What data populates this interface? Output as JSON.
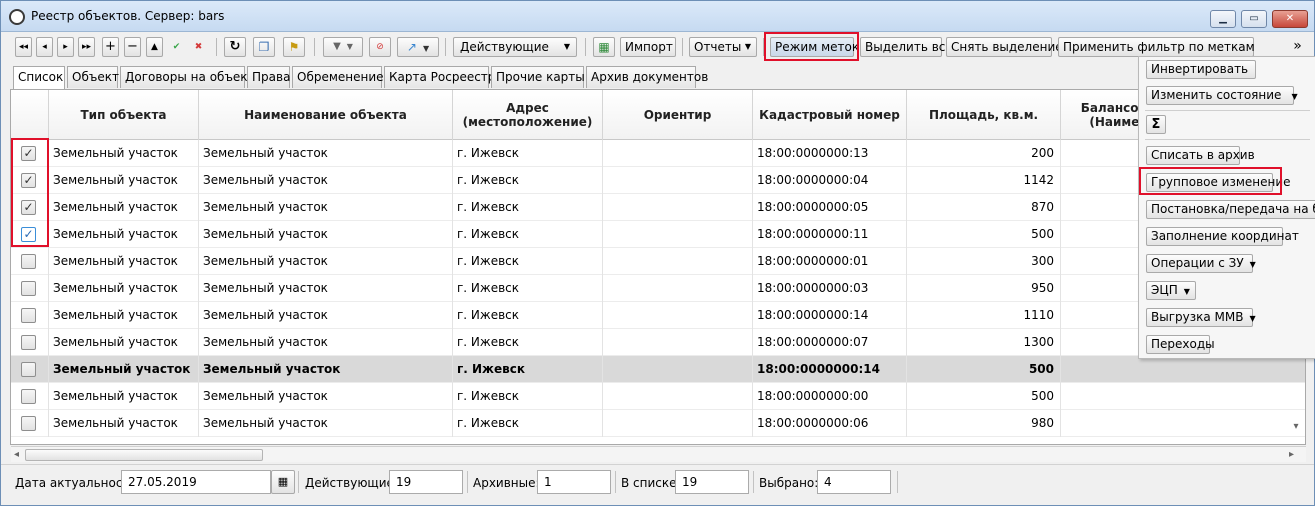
{
  "window": {
    "title": "Реестр объектов. Сервер: bars"
  },
  "toolbar": {
    "nav_first": "◂◂",
    "nav_prev": "◂",
    "nav_next": "▸",
    "nav_last": "▸▸",
    "add": "+",
    "remove": "−",
    "up": "▲",
    "apply": "✔",
    "cancel": "✖",
    "refresh": "↻",
    "copy": "❐",
    "flag": "⚑",
    "filter": "▼",
    "filter_clear": "⊘",
    "arrow": "↗",
    "status_filter": "Действующие",
    "import": "Импорт",
    "reports": "Отчеты",
    "mark_mode": "Режим меток",
    "select_all": "Выделить все",
    "clear_selection": "Снять выделение",
    "apply_filter": "Применить фильтр по меткам",
    "more": "»"
  },
  "tabs": [
    "Список",
    "Объект",
    "Договоры на объект",
    "Права",
    "Обременение",
    "Карта Росреестра",
    "Прочие карты",
    "Архив документов"
  ],
  "grid": {
    "columns": {
      "type": "Тип объекта",
      "name": "Наименование объекта",
      "address": "Адрес (местоположение)",
      "landmark": "Ориентир",
      "cadastral": "Кадастровый номер",
      "area": "Площадь, кв.м.",
      "balance": "Балансоде (Наимен"
    },
    "rows": [
      {
        "checked": true,
        "type": "Земельный участок",
        "name": "Земельный участок",
        "address": "г. Ижевск",
        "landmark": "",
        "cadastral": "18:00:0000000:13",
        "area": "200"
      },
      {
        "checked": true,
        "type": "Земельный участок",
        "name": "Земельный участок",
        "address": "г. Ижевск",
        "landmark": "",
        "cadastral": "18:00:0000000:04",
        "area": "1142"
      },
      {
        "checked": true,
        "type": "Земельный участок",
        "name": "Земельный участок",
        "address": "г. Ижевск",
        "landmark": "",
        "cadastral": "18:00:0000000:05",
        "area": "870"
      },
      {
        "checked": true,
        "type": "Земельный участок",
        "name": "Земельный участок",
        "address": "г. Ижевск",
        "landmark": "",
        "cadastral": "18:00:0000000:11",
        "area": "500"
      },
      {
        "checked": false,
        "type": "Земельный участок",
        "name": "Земельный участок",
        "address": "г. Ижевск",
        "landmark": "",
        "cadastral": "18:00:0000000:01",
        "area": "300"
      },
      {
        "checked": false,
        "type": "Земельный участок",
        "name": "Земельный участок",
        "address": "г. Ижевск",
        "landmark": "",
        "cadastral": "18:00:0000000:03",
        "area": "950"
      },
      {
        "checked": false,
        "type": "Земельный участок",
        "name": "Земельный участок",
        "address": "г. Ижевск",
        "landmark": "",
        "cadastral": "18:00:0000000:14",
        "area": "1110"
      },
      {
        "checked": false,
        "type": "Земельный участок",
        "name": "Земельный участок",
        "address": "г. Ижевск",
        "landmark": "",
        "cadastral": "18:00:0000000:07",
        "area": "1300"
      },
      {
        "checked": false,
        "type": "Земельный участок",
        "name": "Земельный участок",
        "address": "г. Ижевск",
        "landmark": "",
        "cadastral": "18:00:0000000:14",
        "area": "500"
      },
      {
        "checked": false,
        "type": "Земельный участок",
        "name": "Земельный участок",
        "address": "г. Ижевск",
        "landmark": "",
        "cadastral": "18:00:0000000:00",
        "area": "500"
      },
      {
        "checked": false,
        "type": "Земельный участок",
        "name": "Земельный участок",
        "address": "г. Ижевск",
        "landmark": "",
        "cadastral": "18:00:0000000:06",
        "area": "980"
      }
    ]
  },
  "popup_menu": {
    "invert": "Инвертировать",
    "change_state": "Изменить состояние",
    "sum": "Σ",
    "archive": "Списать в архив",
    "group_change": "Групповое изменение",
    "balance_transfer": "Постановка/передача на бала",
    "fill_coords": "Заполнение координат",
    "land_operations": "Операции с ЗУ",
    "eds": "ЭЦП",
    "export_mmv": "Выгрузка ММВ",
    "transitions": "Переходы"
  },
  "statusbar": {
    "date_label": "Дата актуальности",
    "date_value": "27.05.2019",
    "active_label": "Действующие:",
    "active_value": "19",
    "archived_label": "Архивные:",
    "archived_value": "1",
    "in_list_label": "В списке:",
    "in_list_value": "19",
    "selected_label": "Выбрано:",
    "selected_value": "4"
  }
}
